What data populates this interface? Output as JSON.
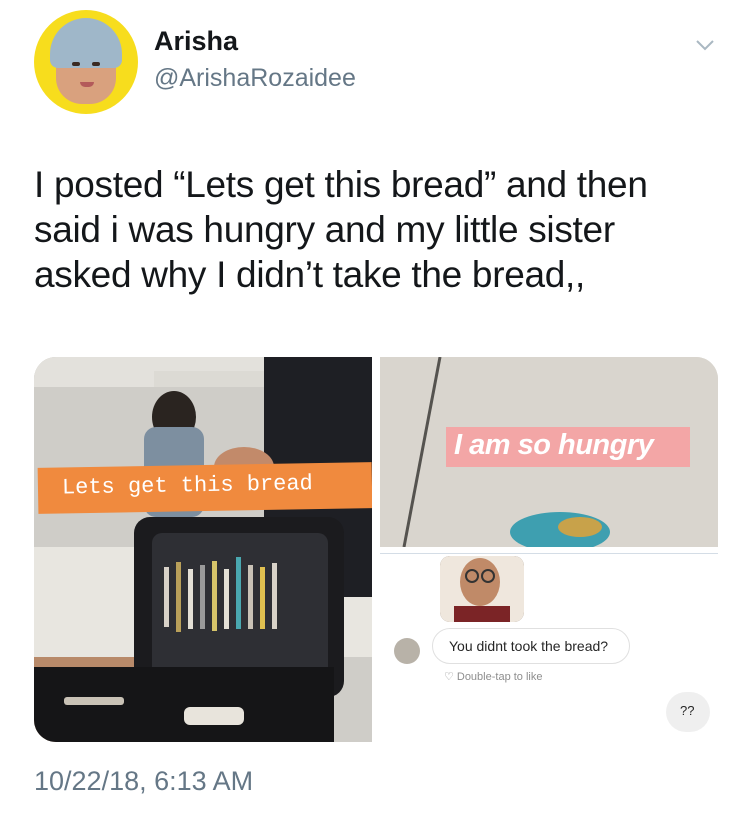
{
  "author": {
    "name": "Arisha",
    "handle": "@ArishaRozaidee",
    "avatar_bg": "#f7dd1d"
  },
  "menu": {
    "icon": "chevron-down-icon"
  },
  "tweet": {
    "text_lines": [
      "I posted “Lets get this bread” and then",
      "said i was hungry and my little sister",
      "asked why I didn’t take the bread,,"
    ],
    "timestamp": "10/22/18, 6:13 AM"
  },
  "media": {
    "left_photo": {
      "sticker_text": "Lets get this bread",
      "sticker_color": "#f08a3e"
    },
    "right_top_photo": {
      "sticker_text": "I am so hungry",
      "sticker_color": "#f3a6a6"
    },
    "right_bottom_dm": {
      "message": "You didnt took the bread?",
      "like_hint": "Double-tap to like",
      "reply": "??"
    }
  }
}
